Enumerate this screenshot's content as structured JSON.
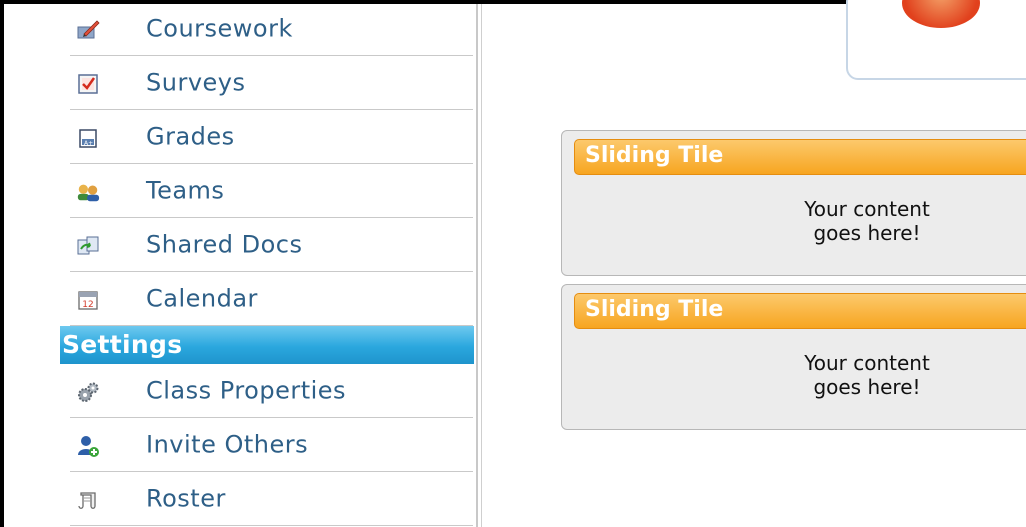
{
  "sidebar": {
    "items": [
      {
        "label": "Coursework",
        "icon": "pencil-paper-icon"
      },
      {
        "label": "Surveys",
        "icon": "checklist-icon"
      },
      {
        "label": "Grades",
        "icon": "grade-sheet-icon"
      },
      {
        "label": "Teams",
        "icon": "people-icon"
      },
      {
        "label": "Shared Docs",
        "icon": "shared-docs-icon"
      },
      {
        "label": "Calendar",
        "icon": "calendar-icon"
      }
    ],
    "section_title": "Settings",
    "settings_items": [
      {
        "label": "Class Properties",
        "icon": "gears-icon"
      },
      {
        "label": "Invite Others",
        "icon": "add-person-icon"
      },
      {
        "label": "Roster",
        "icon": "scroll-icon"
      }
    ]
  },
  "tiles": [
    {
      "title": "Sliding Tile",
      "line1": "Your content",
      "line2": "goes here!"
    },
    {
      "title": "Sliding Tile",
      "line1": "Your content",
      "line2": "goes here!"
    }
  ],
  "icons": {
    "calendar_day": "12"
  },
  "colors": {
    "nav_text": "#2e5f87",
    "section_header": "#2aa7de",
    "tile_header": "#f7a520"
  }
}
